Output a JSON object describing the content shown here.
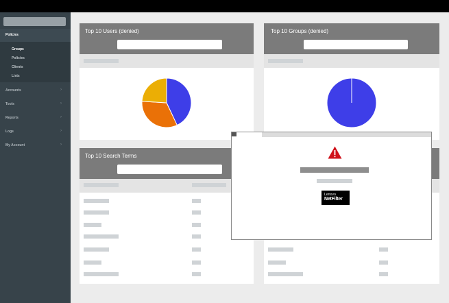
{
  "sidebar": {
    "section": "Policies",
    "subitems": [
      "Groups",
      "Policies",
      "Clients",
      "Lists"
    ],
    "items": [
      "Accounts",
      "Tools",
      "Reports",
      "Logs",
      "My Account"
    ],
    "chevron": "›"
  },
  "panels": {
    "users_title": "Top 10 Users (denied)",
    "groups_title": "Top 10 Groups (denied)",
    "search_terms_title": "Top 10 Search Terms"
  },
  "chart_data": [
    {
      "type": "pie",
      "title": "Top 10 Users (denied)",
      "values": [
        43,
        33,
        24
      ],
      "colors": [
        "#3e3ee8",
        "#ea7107",
        "#ebae05"
      ]
    },
    {
      "type": "pie",
      "title": "Top 10 Groups (denied)",
      "values": [
        100
      ],
      "colors": [
        "#3e3ee8"
      ]
    }
  ],
  "modal": {
    "icon": "warning-icon",
    "logo_line1": "Lenovo",
    "logo_line2": "NetFilter"
  }
}
